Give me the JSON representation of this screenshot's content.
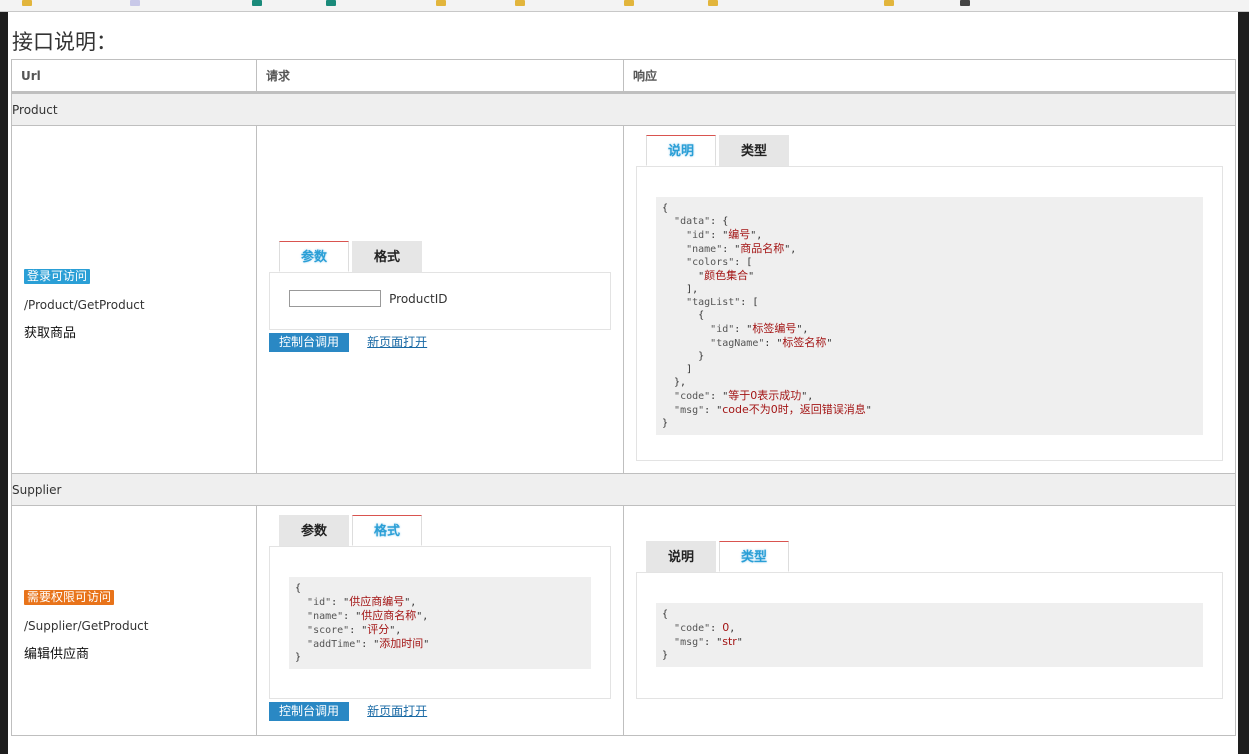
{
  "page": {
    "title": "接口说明："
  },
  "table": {
    "headers": [
      "Url",
      "请求",
      "响应"
    ]
  },
  "groups": [
    {
      "name": "Product",
      "badge": "登录可访问",
      "badge_color": "#2a9fd6",
      "url": "/Product/GetProduct",
      "description": "获取商品",
      "request_tabs": [
        "参数",
        "格式"
      ],
      "param_label": "ProductID",
      "param_value": "",
      "console_button": "控制台调用",
      "open_link": "新页面打开",
      "response_tabs": [
        "说明",
        "类型"
      ]
    },
    {
      "name": "Supplier",
      "badge": "需要权限可访问",
      "badge_color": "#e8731a",
      "url": "/Supplier/GetProduct",
      "description": "编辑供应商",
      "request_tabs": [
        "参数",
        "格式"
      ],
      "console_button": "控制台调用",
      "open_link": "新页面打开",
      "response_tabs": [
        "说明",
        "类型"
      ]
    }
  ],
  "code_blocks": {
    "product_response_fields": {
      "id": "编号",
      "name": "商品名称",
      "colors_item": "颜色集合",
      "tag_id": "标签编号",
      "tag_name": "标签名称",
      "code": "等于0表示成功",
      "msg": "code不为0时，返回错误消息"
    },
    "supplier_request_fields": {
      "id": "供应商编号",
      "name": "供应商名称",
      "score": "评分",
      "addTime": "添加时间"
    },
    "supplier_response_fields": {
      "code": "0",
      "msg": "str"
    }
  }
}
